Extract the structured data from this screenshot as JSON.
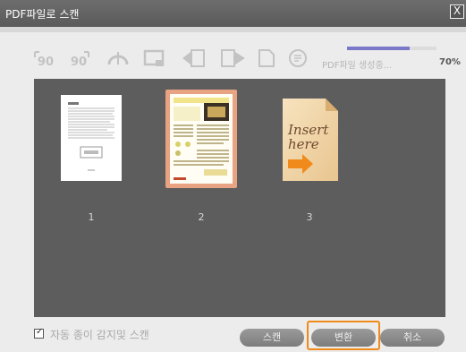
{
  "window": {
    "title": "PDF파일로 스캔",
    "close_label": "X"
  },
  "toolbar": {
    "icons": [
      "rotate-left-90-icon",
      "rotate-right-90-icon",
      "flip-icon",
      "crop-icon",
      "page-prev-icon",
      "page-next-icon",
      "blank-page-icon",
      "pdf-icon"
    ],
    "rotate_left_label": "90",
    "rotate_right_label": "90"
  },
  "progress": {
    "label": "PDF파일 생성중...",
    "value": 0.7,
    "display": "70%"
  },
  "pages": [
    {
      "label": "1",
      "type": "document"
    },
    {
      "label": "2",
      "type": "brochure",
      "selected": true
    },
    {
      "label": "3",
      "type": "insert-here",
      "text_line1": "Insert",
      "text_line2": "here"
    }
  ],
  "bottom": {
    "auto_scan_label": "자동 종이 감지및 스캔",
    "auto_scan_checked": true,
    "scan_label": "스캔",
    "convert_label": "변환",
    "cancel_label": "취소"
  },
  "colors": {
    "accent": "#f08a1a",
    "progress": "#7a78c8",
    "panel": "#5d5d5d"
  }
}
